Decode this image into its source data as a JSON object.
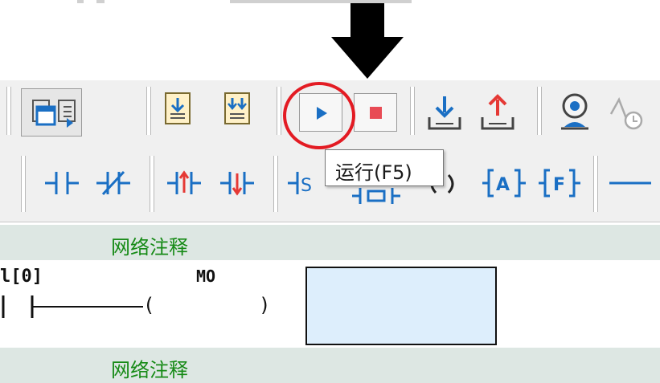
{
  "tooltip": {
    "text": "运行(F5)"
  },
  "network": {
    "comment_label_1": "网络注释",
    "comment_label_2": "网络注释",
    "rung": {
      "contact_label": "l[0]",
      "coil_label": "MO",
      "coil_open": "(",
      "coil_close": ")"
    }
  },
  "annotations": {
    "arrow": "down-arrow-icon",
    "highlight": "red-circle-highlight",
    "highlight_color": "#e31b23"
  },
  "toolbar1": {
    "icons": [
      "window-cascade-icon",
      "window-export-icon",
      "download-doc-icon",
      "download-all-doc-icon",
      "run-icon",
      "stop-icon",
      "write-to-plc-icon",
      "read-from-plc-icon",
      "monitor-icon",
      "timing-chart-icon"
    ]
  },
  "toolbar2": {
    "icons": [
      "no-contact-icon",
      "nc-contact-icon",
      "rising-edge-contact-icon",
      "falling-edge-contact-icon",
      "set-coil-icon",
      "box-instruction-icon",
      "coil-icon",
      "a-instruction-icon",
      "f-instruction-icon",
      "horizontal-line-icon"
    ]
  },
  "colors": {
    "toolbar_bg": "#f0f0f0",
    "comment_bg": "#dde7e3",
    "comment_text": "#168a16",
    "icon_blue": "#1a6fc4",
    "stop_red": "#e84b55",
    "box_fill": "#ddeefc"
  }
}
